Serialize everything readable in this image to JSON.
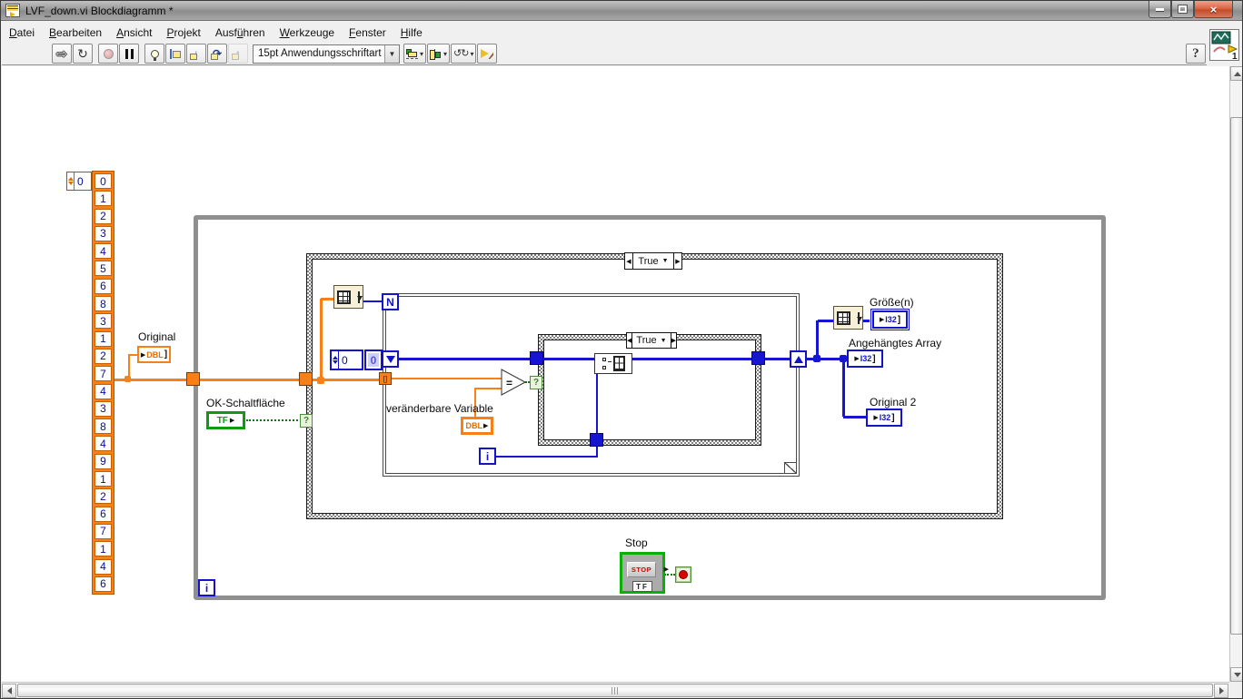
{
  "window": {
    "title": "LVF_down.vi Blockdiagramm *"
  },
  "menu": {
    "items": [
      {
        "label": "Datei",
        "underline": 0
      },
      {
        "label": "Bearbeiten",
        "underline": 0
      },
      {
        "label": "Ansicht",
        "underline": 0
      },
      {
        "label": "Projekt",
        "underline": 0
      },
      {
        "label": "Ausführen",
        "underline": 4
      },
      {
        "label": "Werkzeuge",
        "underline": 0
      },
      {
        "label": "Fenster",
        "underline": 0
      },
      {
        "label": "Hilfe",
        "underline": 0
      }
    ]
  },
  "toolbar": {
    "buttons": [
      {
        "name": "run-button",
        "kind": "k-run",
        "glyph": "⇨",
        "gap": false
      },
      {
        "name": "run-continuously-button",
        "kind": "k-runcont",
        "glyph": "↻",
        "gap": false
      },
      {
        "name": "abort-button",
        "kind": "k-abort",
        "glyph": "",
        "gap": true
      },
      {
        "name": "pause-button",
        "kind": "k-pause",
        "glyph": "",
        "gap": false
      },
      {
        "name": "highlight-execution-button",
        "kind": "k-bulb",
        "glyph": "",
        "gap": true
      },
      {
        "name": "retain-wire-values-button",
        "kind": "k-retain",
        "glyph": "",
        "gap": false
      },
      {
        "name": "step-into-button",
        "kind": "k-stepin",
        "glyph": "↓",
        "gap": false
      },
      {
        "name": "step-over-button",
        "kind": "k-stepover",
        "glyph": "↷",
        "gap": false
      },
      {
        "name": "step-out-button",
        "kind": "k-stepout",
        "glyph": "↑",
        "gap": false
      }
    ],
    "font_selector": "15pt Anwendungsschriftart",
    "buttons2": [
      {
        "name": "align-objects-button",
        "kind": "k-align",
        "glyph": "",
        "dropdown": "▾"
      },
      {
        "name": "distribute-objects-button",
        "kind": "k-distribute",
        "glyph": "",
        "dropdown": "▾"
      },
      {
        "name": "reorder-button",
        "kind": "k-reorder",
        "glyph": "↺↻",
        "dropdown": "▾"
      },
      {
        "name": "cleanup-diagram-button",
        "kind": "k-cleanup",
        "glyph": ""
      }
    ],
    "help_label": "?",
    "vi_badge": "1"
  },
  "diagram": {
    "array_constant": {
      "index": "0",
      "values": [
        "0",
        "1",
        "2",
        "3",
        "4",
        "5",
        "6",
        "8",
        "3",
        "1",
        "2",
        "7",
        "4",
        "3",
        "8",
        "4",
        "9",
        "1",
        "2",
        "6",
        "7",
        "1",
        "4",
        "6"
      ]
    },
    "outer_case": {
      "selector": "True"
    },
    "inner_case": {
      "selector": "True"
    },
    "for_loop": {
      "count_label": "N",
      "iteration_label": "i"
    },
    "while_loop": {
      "iteration_label": "i"
    },
    "constants": {
      "sr_init": "0",
      "sr_init2": "0"
    },
    "equals_label": "=",
    "index_tunnel_label": "[]",
    "selector_tunnel_label": "?",
    "original": {
      "label": "Original",
      "arrow": "▶",
      "type": "DBL",
      "bracket": "]"
    },
    "ok_button": {
      "label": "OK-Schaltfläche",
      "type": "TF",
      "arrow": "▶"
    },
    "variable": {
      "label": "veränderbare Variable",
      "type": "DBL",
      "arrow": "▶"
    },
    "size_out": {
      "label": "Größe(n)",
      "arrow": "▶",
      "type": "I32",
      "bracket": "]"
    },
    "appended": {
      "label": "Angehängtes Array",
      "arrow": "▶",
      "type": "I32",
      "bracket": "]"
    },
    "original2": {
      "label": "Original 2",
      "arrow": "▶",
      "type": "I32",
      "bracket": "]"
    },
    "stop": {
      "label": "Stop",
      "button_text": "STOP",
      "type": "TF"
    },
    "colors": {
      "dbl_orange": "#f88017",
      "i32_blue": "#1616d1",
      "bool_green": "#0f9b0f"
    }
  }
}
